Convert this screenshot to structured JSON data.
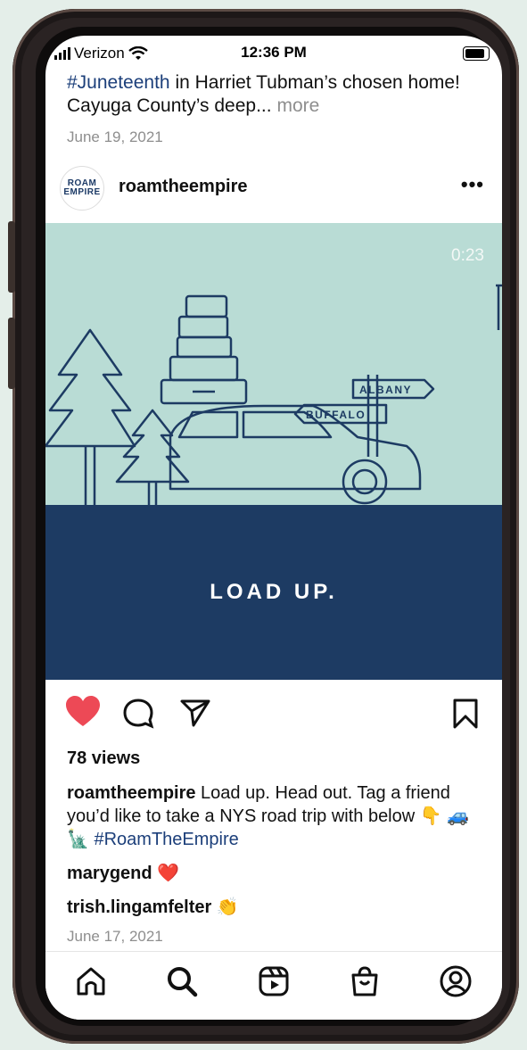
{
  "status": {
    "carrier": "Verizon",
    "time": "12:36 PM"
  },
  "prev_post": {
    "hashtag": "#Juneteenth",
    "text": " in Harriet Tubman’s chosen home! Cayuga County’s deep...",
    "more": "more",
    "date": "June 19, 2021"
  },
  "post": {
    "avatar_line1": "ROAM",
    "avatar_line2": "EMPIRE",
    "username": "roamtheempire",
    "timer": "0:23",
    "sign_albany": "ALBANY",
    "sign_buffalo": "BUFFALO",
    "media_caption": "LOAD UP.",
    "views": "78 views",
    "caption_user": "roamtheempire",
    "caption_text": " Load up. Head out. Tag a friend you’d like to take a NYS road trip with below",
    "caption_emojis": " 👇 🚙 🗽 ",
    "caption_hashtag": "#RoamTheEmpire",
    "comments": [
      {
        "user": "marygend",
        "emoji": "❤️"
      },
      {
        "user": "trish.lingamfelter",
        "emoji": "👏"
      }
    ],
    "date": "June 17, 2021",
    "liked": true
  },
  "icons": [
    "heart-icon",
    "comment-icon",
    "share-icon",
    "bookmark-icon",
    "home-icon",
    "search-icon",
    "reels-icon",
    "shop-icon",
    "profile-icon"
  ],
  "colors": {
    "like_red": "#ed4956",
    "hashtag_blue": "#1c3f7a",
    "media_bg": "#b9dcd5",
    "media_ground": "#1d3b63"
  }
}
